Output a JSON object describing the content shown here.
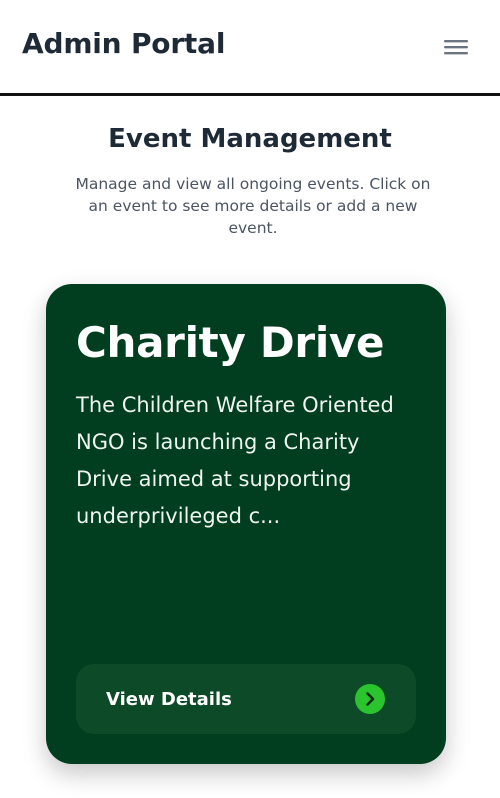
{
  "header": {
    "title": "Admin Portal",
    "menu_icon": "hamburger-menu-icon"
  },
  "main": {
    "title": "Event Management",
    "description": "Manage and view all ongoing events. Click on an event to see more details or add a new event."
  },
  "events": [
    {
      "title": "Charity Drive",
      "description": "The Children Welfare Oriented NGO is launching a Charity Drive aimed at supporting underprivileged c...",
      "button_label": "View Details",
      "button_icon": "chevron-right-icon"
    }
  ],
  "colors": {
    "card_background": "#013d1f",
    "button_background": "#0c4a28",
    "accent": "#2ac42f",
    "text_dark": "#1f2a37"
  }
}
